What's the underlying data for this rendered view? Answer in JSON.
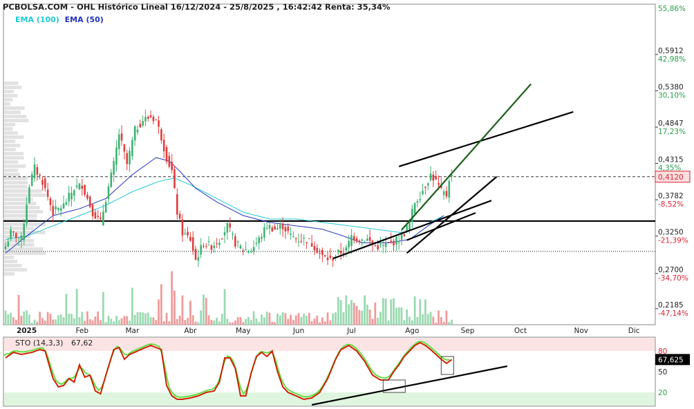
{
  "header": {
    "title": "PCBOLSA.COM - OHL Histórico Lineal 16/12/2024 - 25/8/2025 , 16:42:42 Renta: 35,34%"
  },
  "legend": {
    "ema100": "EMA (100)",
    "ema50": "EMA (50)"
  },
  "colors": {
    "up": "#3cb371",
    "down": "#e03c3c",
    "ema100": "#22c7d6",
    "ema50": "#2233bb",
    "trend_black": "#000000",
    "trend_green": "#1a5e1a",
    "stoch_k": "#cc2200",
    "stoch_d": "#66dd44"
  },
  "chart_data": [
    {
      "type": "candlestick",
      "title": "PCBOLSA.COM - OHL Histórico Lineal 16/12/2024 - 25/8/2025 , 16:42:42 Renta: 35,34%",
      "ylim": [
        0.195,
        0.665
      ],
      "y_ticks": [
        {
          "price": "0,5912",
          "pct": "42,98%",
          "value": 0.5912
        },
        {
          "price": "0,5380",
          "pct": "30,10%",
          "value": 0.538
        },
        {
          "price": "0,4847",
          "pct": "17,23%",
          "value": 0.4847
        },
        {
          "price": "0,4315",
          "pct": "4,35%",
          "value": 0.4315
        },
        {
          "price": "0,3782",
          "pct": "-8,52%",
          "value": 0.3782
        },
        {
          "price": "0,3250",
          "pct": "-21,39%",
          "value": 0.325
        },
        {
          "price": "0,2700",
          "pct": "-34,70%",
          "value": 0.27
        },
        {
          "price": "0,2185",
          "pct": "-47,14%",
          "value": 0.2185
        }
      ],
      "top_pct_label": "55,86%",
      "x_labels": [
        {
          "label": "2025",
          "index": 8
        },
        {
          "label": "Feb",
          "index": 29
        },
        {
          "label": "Mar",
          "index": 48
        },
        {
          "label": "Abr",
          "index": 70
        },
        {
          "label": "May",
          "index": 90
        },
        {
          "label": "Jun",
          "index": 111
        },
        {
          "label": "Jul",
          "index": 131
        },
        {
          "label": "Ago",
          "index": 154
        },
        {
          "label": "Sep",
          "index": 175
        },
        {
          "label": "Oct",
          "index": 195
        },
        {
          "label": "Nov",
          "index": 218
        },
        {
          "label": "Dic",
          "index": 238
        }
      ],
      "last_price_label": "0,4120",
      "last_price": 0.412,
      "support_line": 0.347,
      "dotted_line": 0.3025,
      "close_anchors": [
        [
          0,
          0.31
        ],
        [
          2,
          0.33
        ],
        [
          6,
          0.32
        ],
        [
          9,
          0.4
        ],
        [
          11,
          0.425
        ],
        [
          14,
          0.405
        ],
        [
          18,
          0.36
        ],
        [
          22,
          0.37
        ],
        [
          26,
          0.395
        ],
        [
          29,
          0.4
        ],
        [
          33,
          0.36
        ],
        [
          36,
          0.345
        ],
        [
          38,
          0.38
        ],
        [
          41,
          0.43
        ],
        [
          43,
          0.475
        ],
        [
          46,
          0.43
        ],
        [
          49,
          0.48
        ],
        [
          52,
          0.495
        ],
        [
          55,
          0.5
        ],
        [
          57,
          0.495
        ],
        [
          59,
          0.47
        ],
        [
          61,
          0.44
        ],
        [
          63,
          0.42
        ],
        [
          65,
          0.36
        ],
        [
          67,
          0.33
        ],
        [
          70,
          0.32
        ],
        [
          72,
          0.29
        ],
        [
          75,
          0.315
        ],
        [
          78,
          0.31
        ],
        [
          81,
          0.32
        ],
        [
          84,
          0.34
        ],
        [
          87,
          0.315
        ],
        [
          90,
          0.305
        ],
        [
          93,
          0.305
        ],
        [
          96,
          0.32
        ],
        [
          99,
          0.34
        ],
        [
          102,
          0.335
        ],
        [
          105,
          0.34
        ],
        [
          108,
          0.325
        ],
        [
          111,
          0.32
        ],
        [
          114,
          0.32
        ],
        [
          117,
          0.31
        ],
        [
          120,
          0.295
        ],
        [
          123,
          0.29
        ],
        [
          126,
          0.3
        ],
        [
          129,
          0.305
        ],
        [
          131,
          0.325
        ],
        [
          134,
          0.32
        ],
        [
          137,
          0.32
        ],
        [
          140,
          0.31
        ],
        [
          143,
          0.31
        ],
        [
          146,
          0.315
        ],
        [
          149,
          0.32
        ],
        [
          151,
          0.33
        ],
        [
          153,
          0.345
        ],
        [
          155,
          0.375
        ],
        [
          157,
          0.385
        ],
        [
          159,
          0.4
        ],
        [
          161,
          0.415
        ],
        [
          163,
          0.405
        ],
        [
          165,
          0.39
        ],
        [
          167,
          0.385
        ],
        [
          168,
          0.41
        ],
        [
          169,
          0.412
        ]
      ],
      "ema50_anchors": [
        [
          0,
          0.3
        ],
        [
          8,
          0.325
        ],
        [
          18,
          0.355
        ],
        [
          28,
          0.365
        ],
        [
          38,
          0.38
        ],
        [
          48,
          0.415
        ],
        [
          57,
          0.44
        ],
        [
          62,
          0.435
        ],
        [
          66,
          0.42
        ],
        [
          72,
          0.395
        ],
        [
          80,
          0.375
        ],
        [
          90,
          0.355
        ],
        [
          100,
          0.345
        ],
        [
          110,
          0.34
        ],
        [
          120,
          0.335
        ],
        [
          128,
          0.325
        ],
        [
          135,
          0.315
        ],
        [
          145,
          0.315
        ],
        [
          153,
          0.32
        ],
        [
          160,
          0.34
        ],
        [
          166,
          0.355
        ]
      ],
      "ema100_anchors": [
        [
          0,
          0.32
        ],
        [
          8,
          0.325
        ],
        [
          18,
          0.34
        ],
        [
          28,
          0.355
        ],
        [
          38,
          0.37
        ],
        [
          48,
          0.39
        ],
        [
          58,
          0.405
        ],
        [
          64,
          0.41
        ],
        [
          70,
          0.4
        ],
        [
          80,
          0.38
        ],
        [
          90,
          0.36
        ],
        [
          100,
          0.35
        ],
        [
          110,
          0.35
        ],
        [
          120,
          0.345
        ],
        [
          130,
          0.34
        ],
        [
          140,
          0.335
        ],
        [
          150,
          0.33
        ],
        [
          158,
          0.34
        ],
        [
          166,
          0.355
        ]
      ],
      "trend_lines": [
        {
          "color": "black",
          "from": [
            152,
            0.319
          ],
          "to": [
            178,
            0.359
          ]
        },
        {
          "color": "black",
          "from": [
            152,
            0.3
          ],
          "to": [
            186,
            0.412
          ]
        },
        {
          "color": "black",
          "from": [
            149,
            0.427
          ],
          "to": [
            215,
            0.507
          ]
        },
        {
          "color": "green",
          "from": [
            150,
            0.334
          ],
          "to": [
            199,
            0.548
          ]
        },
        {
          "color": "black",
          "from": [
            124,
            0.292
          ],
          "to": [
            184,
            0.377
          ]
        }
      ]
    },
    {
      "type": "line",
      "title": "STO (14,3,3)",
      "value_label": "67,62",
      "current_value": "67,625",
      "ylim": [
        0,
        100
      ],
      "y_ticks": [
        80,
        50,
        20
      ],
      "overbought": 80,
      "oversold": 20,
      "k_anchors": [
        [
          0,
          70
        ],
        [
          3,
          78
        ],
        [
          6,
          75
        ],
        [
          10,
          78
        ],
        [
          13,
          82
        ],
        [
          15,
          80
        ],
        [
          18,
          40
        ],
        [
          20,
          28
        ],
        [
          22,
          30
        ],
        [
          24,
          40
        ],
        [
          26,
          35
        ],
        [
          28,
          60
        ],
        [
          30,
          42
        ],
        [
          32,
          45
        ],
        [
          34,
          22
        ],
        [
          36,
          18
        ],
        [
          38,
          45
        ],
        [
          41,
          82
        ],
        [
          43,
          85
        ],
        [
          45,
          68
        ],
        [
          47,
          75
        ],
        [
          50,
          80
        ],
        [
          53,
          85
        ],
        [
          55,
          88
        ],
        [
          57,
          85
        ],
        [
          59,
          82
        ],
        [
          61,
          30
        ],
        [
          63,
          15
        ],
        [
          65,
          10
        ],
        [
          67,
          10
        ],
        [
          70,
          12
        ],
        [
          73,
          15
        ],
        [
          76,
          20
        ],
        [
          79,
          22
        ],
        [
          81,
          35
        ],
        [
          83,
          70
        ],
        [
          85,
          70
        ],
        [
          87,
          55
        ],
        [
          89,
          15
        ],
        [
          91,
          15
        ],
        [
          93,
          48
        ],
        [
          95,
          72
        ],
        [
          97,
          78
        ],
        [
          99,
          72
        ],
        [
          101,
          80
        ],
        [
          103,
          50
        ],
        [
          105,
          28
        ],
        [
          107,
          20
        ],
        [
          110,
          15
        ],
        [
          113,
          10
        ],
        [
          116,
          12
        ],
        [
          119,
          20
        ],
        [
          122,
          40
        ],
        [
          125,
          68
        ],
        [
          127,
          82
        ],
        [
          130,
          88
        ],
        [
          133,
          80
        ],
        [
          136,
          65
        ],
        [
          139,
          45
        ],
        [
          142,
          38
        ],
        [
          145,
          38
        ],
        [
          147,
          50
        ],
        [
          149,
          60
        ],
        [
          151,
          72
        ],
        [
          153,
          80
        ],
        [
          155,
          88
        ],
        [
          157,
          92
        ],
        [
          159,
          88
        ],
        [
          161,
          82
        ],
        [
          163,
          75
        ],
        [
          165,
          68
        ],
        [
          167,
          62
        ],
        [
          169,
          67.625
        ]
      ]
    }
  ]
}
